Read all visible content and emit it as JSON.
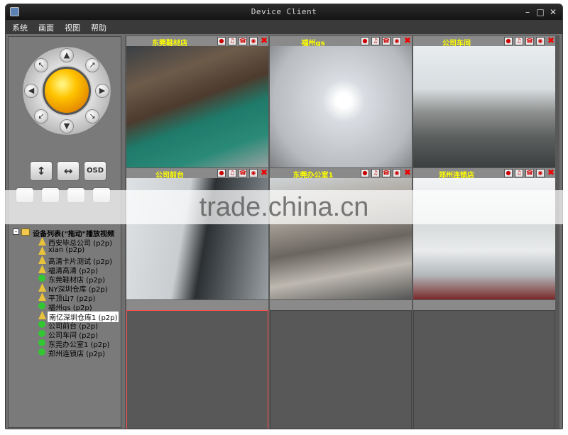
{
  "window": {
    "title": "Device Client"
  },
  "menu": [
    "系统",
    "画面",
    "视图",
    "帮助"
  ],
  "controls": {
    "osd_label": "OSD"
  },
  "tree": {
    "root": "设备列表(\"拖动\"播放视频",
    "devices": [
      {
        "name": "西安毕总公司 (p2p)",
        "status": "cam"
      },
      {
        "name": "xian (p2p)",
        "status": "cam"
      },
      {
        "name": "高清卡片测试 (p2p)",
        "status": "cam"
      },
      {
        "name": "福清高清 (p2p)",
        "status": "cam"
      },
      {
        "name": "东莞鞋材店 (p2p)",
        "status": "on"
      },
      {
        "name": "NY深圳仓库 (p2p)",
        "status": "cam"
      },
      {
        "name": "平顶山7 (p2p)",
        "status": "cam"
      },
      {
        "name": "福州gs (p2p)",
        "status": "on"
      },
      {
        "name": "南亿深圳仓库1 (p2p)",
        "status": "cam",
        "selected": true
      },
      {
        "name": "公司前台 (p2p)",
        "status": "on"
      },
      {
        "name": "公司车间 (p2p)",
        "status": "on"
      },
      {
        "name": "东莞办公室1 (p2p)",
        "status": "on"
      },
      {
        "name": "郑州连锁店 (p2p)",
        "status": "on"
      }
    ]
  },
  "cameras": [
    {
      "name": "东莞鞋材店"
    },
    {
      "name": "福州gs"
    },
    {
      "name": "公司车间"
    },
    {
      "name": "公司前台"
    },
    {
      "name": "东莞办公室1"
    },
    {
      "name": "郑州连锁店"
    }
  ],
  "watermark": "trade.china.cn"
}
